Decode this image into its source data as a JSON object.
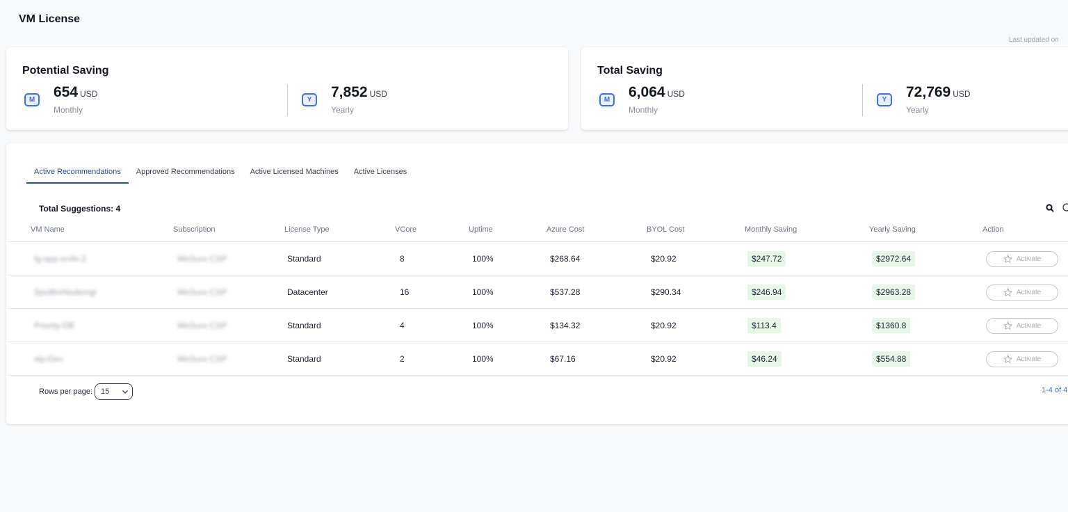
{
  "page": {
    "title": "VM License",
    "last_updated": "Last updated on"
  },
  "potential_saving": {
    "title": "Potential Saving",
    "monthly": {
      "icon_letter": "M",
      "value": "654",
      "unit": "USD",
      "period": "Monthly"
    },
    "yearly": {
      "icon_letter": "Y",
      "value": "7,852",
      "unit": "USD",
      "period": "Yearly"
    }
  },
  "total_saving": {
    "title": "Total Saving",
    "monthly": {
      "icon_letter": "M",
      "value": "6,064",
      "unit": "USD",
      "period": "Monthly"
    },
    "yearly": {
      "icon_letter": "Y",
      "value": "72,769",
      "unit": "USD",
      "period": "Yearly"
    }
  },
  "tabs": [
    {
      "label": "Active Recommendations",
      "active": true
    },
    {
      "label": "Approved Recommendations",
      "active": false
    },
    {
      "label": "Active Licensed Machines",
      "active": false
    },
    {
      "label": "Active Licenses",
      "active": false
    }
  ],
  "table": {
    "total_label": "Total Suggestions: 4",
    "headers": [
      "VM Name",
      "Subscription",
      "License Type",
      "VCore",
      "Uptime",
      "Azure Cost",
      "BYOL Cost",
      "Monthly Saving",
      "Yearly Saving",
      "Action"
    ],
    "rows": [
      {
        "vm_name": "fg-app-srvfe-2",
        "subscription": "WeSure CSP",
        "license_type": "Standard",
        "vcore": "8",
        "uptime": "100%",
        "azure_cost": "$268.64",
        "byol_cost": "$20.92",
        "monthly_saving": "$247.72",
        "yearly_saving": "$2972.64",
        "action": "Activate"
      },
      {
        "vm_name": "SpotfireNodemgr",
        "subscription": "WeSure CSP",
        "license_type": "Datacenter",
        "vcore": "16",
        "uptime": "100%",
        "azure_cost": "$537.28",
        "byol_cost": "$290.34",
        "monthly_saving": "$246.94",
        "yearly_saving": "$2963.28",
        "action": "Activate"
      },
      {
        "vm_name": "Priority-DB",
        "subscription": "WeSure CSP",
        "license_type": "Standard",
        "vcore": "4",
        "uptime": "100%",
        "azure_cost": "$134.32",
        "byol_cost": "$20.92",
        "monthly_saving": "$113.4",
        "yearly_saving": "$1360.8",
        "action": "Activate"
      },
      {
        "vm_name": "nlp-Dev",
        "subscription": "WeSure CSP",
        "license_type": "Standard",
        "vcore": "2",
        "uptime": "100%",
        "azure_cost": "$67.16",
        "byol_cost": "$20.92",
        "monthly_saving": "$46.24",
        "yearly_saving": "$554.88",
        "action": "Activate"
      }
    ]
  },
  "pagination": {
    "rows_label": "Rows per page:",
    "rows_value": "15",
    "range": "1-4 of 4"
  },
  "colors": {
    "accent": "#2a4d8f",
    "icon_blue": "#3f6fe0",
    "saving_bg": "#e6f7ea"
  }
}
